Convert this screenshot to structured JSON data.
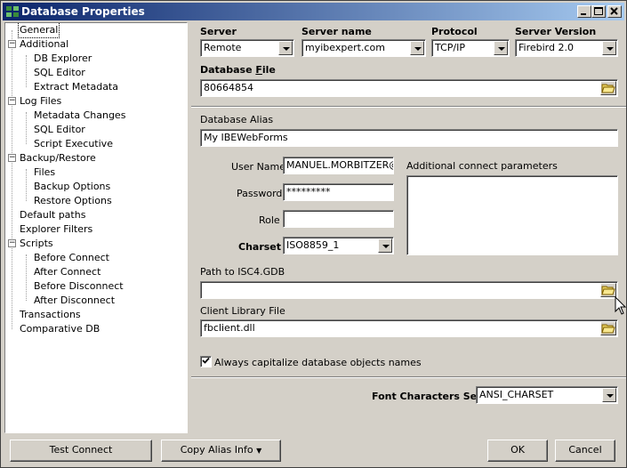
{
  "window": {
    "title": "Database Properties"
  },
  "tree": {
    "items": [
      {
        "label": "General",
        "level": 0,
        "expander": "",
        "selected": true
      },
      {
        "label": "Additional",
        "level": 0,
        "expander": "minus"
      },
      {
        "label": "DB Explorer",
        "level": 1
      },
      {
        "label": "SQL Editor",
        "level": 1
      },
      {
        "label": "Extract Metadata",
        "level": 1
      },
      {
        "label": "Log Files",
        "level": 0,
        "expander": "minus"
      },
      {
        "label": "Metadata Changes",
        "level": 1
      },
      {
        "label": "SQL Editor",
        "level": 1
      },
      {
        "label": "Script Executive",
        "level": 1
      },
      {
        "label": "Backup/Restore",
        "level": 0,
        "expander": "minus"
      },
      {
        "label": "Files",
        "level": 1
      },
      {
        "label": "Backup Options",
        "level": 1
      },
      {
        "label": "Restore Options",
        "level": 1
      },
      {
        "label": "Default paths",
        "level": 0
      },
      {
        "label": "Explorer Filters",
        "level": 0
      },
      {
        "label": "Scripts",
        "level": 0,
        "expander": "minus"
      },
      {
        "label": "Before Connect",
        "level": 1
      },
      {
        "label": "After Connect",
        "level": 1
      },
      {
        "label": "Before Disconnect",
        "level": 1
      },
      {
        "label": "After Disconnect",
        "level": 1
      },
      {
        "label": "Transactions",
        "level": 0
      },
      {
        "label": "Comparative DB",
        "level": 0
      }
    ]
  },
  "general": {
    "server_label": "Server",
    "server_value": "Remote",
    "server_name_label": "Server name",
    "server_name_value": "myibexpert.com",
    "protocol_label": "Protocol",
    "protocol_value": "TCP/IP",
    "server_version_label": "Server Version",
    "server_version_value": "Firebird 2.0",
    "db_file_label_pre": "Database ",
    "db_file_label_u": "F",
    "db_file_label_post": "ile",
    "db_file_value": "80664854",
    "alias_label": "Database Alias",
    "alias_value": "My IBEWebForms",
    "user_name_label": "User Name",
    "user_name_value": "MANUEL.MORBITZER@M",
    "password_label": "Password",
    "password_value": "*********",
    "role_label": "Role",
    "role_value": "",
    "charset_label": "Charset",
    "charset_value": "ISO8859_1",
    "additional_params_label": "Additional connect parameters",
    "additional_params_value": "",
    "isc4_label": "Path to ISC4.GDB",
    "isc4_value": "",
    "client_lib_label": "Client Library File",
    "client_lib_value": "fbclient.dll",
    "capitalize_label": "Always capitalize database objects names",
    "capitalize_checked": true,
    "font_charset_label": "Font Characters Set",
    "font_charset_value": "ANSI_CHARSET"
  },
  "buttons": {
    "test_connect": "Test Connect",
    "copy_alias": "Copy Alias Info",
    "ok": "OK",
    "cancel": "Cancel"
  }
}
